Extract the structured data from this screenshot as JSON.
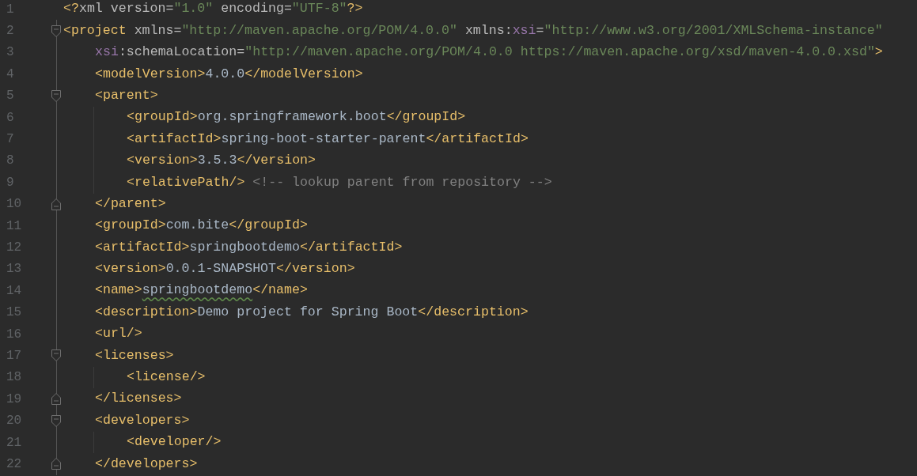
{
  "editor": {
    "lines": [
      {
        "number": "1",
        "tokens": [
          {
            "text": "<?",
            "kind": "tag"
          },
          {
            "text": "xml ",
            "kind": "plain"
          },
          {
            "text": "version",
            "kind": "attr"
          },
          {
            "text": "=",
            "kind": "plain"
          },
          {
            "text": "\"1.0\" ",
            "kind": "value"
          },
          {
            "text": "encoding",
            "kind": "attr"
          },
          {
            "text": "=",
            "kind": "plain"
          },
          {
            "text": "\"UTF-8\"",
            "kind": "value"
          },
          {
            "text": "?>",
            "kind": "tag"
          }
        ]
      },
      {
        "number": "2",
        "kind": "fold_start",
        "tokens": [
          {
            "text": "<project ",
            "kind": "tag"
          },
          {
            "text": "xmlns",
            "kind": "attr"
          },
          {
            "text": "=",
            "kind": "plain"
          },
          {
            "text": "\"http://maven.apache.org/POM/4.0.0\" ",
            "kind": "value"
          },
          {
            "text": "xmlns:",
            "kind": "attr"
          },
          {
            "text": "xsi",
            "kind": "ns"
          },
          {
            "text": "=",
            "kind": "plain"
          },
          {
            "text": "\"http://www.w3.org/2001/XMLSchema-instance\"",
            "kind": "value"
          }
        ],
        "children": [
          {
            "number": "3",
            "tokens": [
              {
                "text": "xsi",
                "kind": "ns"
              },
              {
                "text": ":schemaLocation",
                "kind": "attr"
              },
              {
                "text": "=",
                "kind": "plain"
              },
              {
                "text": "\"http://maven.apache.org/POM/4.0.0 https://maven.apache.org/xsd/maven-4.0.0.xsd\"",
                "kind": "value"
              },
              {
                "text": ">",
                "kind": "tag"
              }
            ]
          },
          {
            "number": "4",
            "tokens": [
              {
                "text": "<modelVersion>",
                "kind": "tag"
              },
              {
                "text": "4.0.0",
                "kind": "text"
              },
              {
                "text": "</modelVersion>",
                "kind": "tag"
              }
            ]
          },
          {
            "number": "5",
            "kind": "fold_start",
            "tokens": [
              {
                "text": "<parent>",
                "kind": "tag"
              }
            ],
            "children": [
              {
                "number": "6",
                "tokens": [
                  {
                    "text": "<groupId>",
                    "kind": "tag"
                  },
                  {
                    "text": "org.springframework.boot",
                    "kind": "text"
                  },
                  {
                    "text": "</groupId>",
                    "kind": "tag"
                  }
                ]
              },
              {
                "number": "7",
                "tokens": [
                  {
                    "text": "<artifactId>",
                    "kind": "tag"
                  },
                  {
                    "text": "spring-boot-starter-parent",
                    "kind": "text"
                  },
                  {
                    "text": "</artifactId>",
                    "kind": "tag"
                  }
                ]
              },
              {
                "number": "8",
                "tokens": [
                  {
                    "text": "<version>",
                    "kind": "tag"
                  },
                  {
                    "text": "3.5.3",
                    "kind": "text"
                  },
                  {
                    "text": "</version>",
                    "kind": "tag"
                  }
                ]
              },
              {
                "number": "9",
                "tokens": [
                  {
                    "text": "<relativePath/> ",
                    "kind": "tag"
                  },
                  {
                    "text": "<!-- lookup parent from repository -->",
                    "kind": "comment"
                  }
                ]
              }
            ]
          },
          {
            "number": "10",
            "kind": "fold_end",
            "tokens": [
              {
                "text": "</parent>",
                "kind": "tag"
              }
            ]
          },
          {
            "number": "11",
            "tokens": [
              {
                "text": "<groupId>",
                "kind": "tag"
              },
              {
                "text": "com.bite",
                "kind": "text"
              },
              {
                "text": "</groupId>",
                "kind": "tag"
              }
            ]
          },
          {
            "number": "12",
            "tokens": [
              {
                "text": "<artifactId>",
                "kind": "tag"
              },
              {
                "text": "springbootdemo",
                "kind": "text"
              },
              {
                "text": "</artifactId>",
                "kind": "tag"
              }
            ]
          },
          {
            "number": "13",
            "tokens": [
              {
                "text": "<version>",
                "kind": "tag"
              },
              {
                "text": "0.0.1-SNAPSHOT",
                "kind": "text"
              },
              {
                "text": "</version>",
                "kind": "tag"
              }
            ]
          },
          {
            "number": "14",
            "tokens": [
              {
                "text": "<name>",
                "kind": "tag"
              },
              {
                "text": "springbootdemo",
                "kind": "text",
                "spell_warning": true
              },
              {
                "text": "</name>",
                "kind": "tag"
              }
            ]
          },
          {
            "number": "15",
            "tokens": [
              {
                "text": "<description>",
                "kind": "tag"
              },
              {
                "text": "Demo project for Spring Boot",
                "kind": "text"
              },
              {
                "text": "</description>",
                "kind": "tag"
              }
            ]
          },
          {
            "number": "16",
            "tokens": [
              {
                "text": "<url/>",
                "kind": "tag"
              }
            ]
          },
          {
            "number": "17",
            "kind": "fold_start",
            "tokens": [
              {
                "text": "<licenses>",
                "kind": "tag"
              }
            ],
            "children": [
              {
                "number": "18",
                "tokens": [
                  {
                    "text": "<license/>",
                    "kind": "tag"
                  }
                ]
              }
            ]
          },
          {
            "number": "19",
            "kind": "fold_end",
            "tokens": [
              {
                "text": "</licenses>",
                "kind": "tag"
              }
            ]
          },
          {
            "number": "20",
            "kind": "fold_start",
            "tokens": [
              {
                "text": "<developers>",
                "kind": "tag"
              }
            ],
            "children": [
              {
                "number": "21",
                "tokens": [
                  {
                    "text": "<developer/>",
                    "kind": "tag"
                  }
                ]
              }
            ]
          },
          {
            "number": "22",
            "kind": "fold_end",
            "tokens": [
              {
                "text": "</developers>",
                "kind": "tag"
              }
            ]
          }
        ]
      }
    ]
  }
}
